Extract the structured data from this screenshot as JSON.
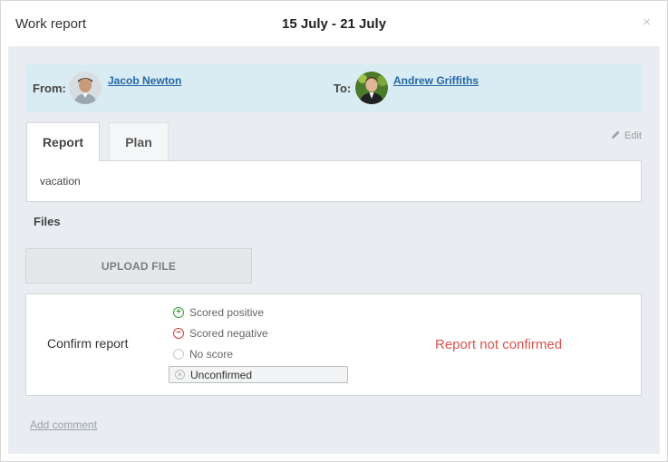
{
  "dialog": {
    "title": "Work report",
    "period": "15 July - 21 July",
    "close_icon": "close-icon"
  },
  "people": {
    "from_label": "From:",
    "from_name": "Jacob Newton",
    "to_label": "To:",
    "to_name": "Andrew Griffiths"
  },
  "tabs": [
    {
      "label": "Report",
      "active": true
    },
    {
      "label": "Plan",
      "active": false
    }
  ],
  "edit": {
    "label": "Edit",
    "icon": "pencil-icon"
  },
  "report": {
    "text": "vacation"
  },
  "files": {
    "label": "Files",
    "upload_label": "UPLOAD FILE"
  },
  "confirm": {
    "label": "Confirm report",
    "options": [
      {
        "label": "Scored positive",
        "icon": "plus-circle-icon",
        "color": "#3c9a3c"
      },
      {
        "label": "Scored negative",
        "icon": "minus-circle-icon",
        "color": "#cc3b3b"
      },
      {
        "label": "No score",
        "icon": "empty-circle-icon",
        "color": "#c9c9c9"
      }
    ],
    "selected": {
      "label": "Unconfirmed",
      "icon": "x-circle-icon"
    },
    "status": "Report not confirmed",
    "status_color": "#d9534f"
  },
  "comment": {
    "label": "Add comment"
  },
  "colors": {
    "link": "#2467a6",
    "people_bar": "#d9ebf3",
    "body_bg": "#e9edf1"
  }
}
